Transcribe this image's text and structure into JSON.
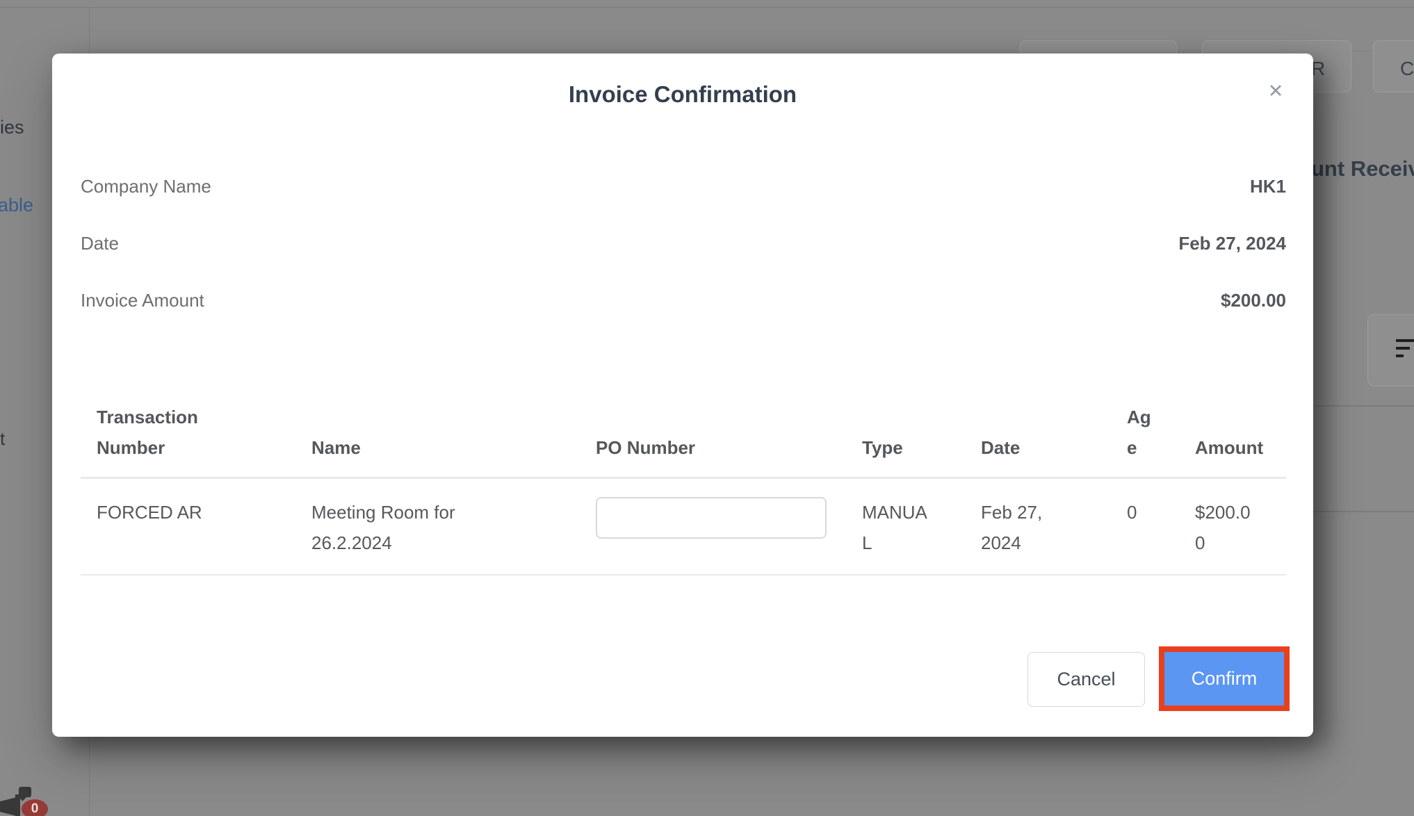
{
  "modal": {
    "title": "Invoice Confirmation",
    "close_icon": "✕",
    "fields": [
      {
        "label": "Company Name",
        "value": "HK1"
      },
      {
        "label": "Date",
        "value": "Feb 27, 2024"
      },
      {
        "label": "Invoice Amount",
        "value": "$200.00"
      }
    ],
    "table": {
      "headers": [
        "Transaction Number",
        "Name",
        "PO Number",
        "Type",
        "Date",
        "Age",
        "Amount"
      ],
      "rows": [
        {
          "transaction_number": "FORCED AR",
          "name": "Meeting Room for 26.2.2024",
          "po_number": "",
          "type": "MANUAL",
          "date": "Feb 27, 2024",
          "age": "0",
          "amount": "$200.00"
        }
      ]
    },
    "buttons": {
      "cancel": "Cancel",
      "confirm": "Confirm"
    }
  },
  "background": {
    "top_buttons": [
      {
        "label": ""
      },
      {
        "label": "R"
      },
      {
        "label": "C"
      }
    ],
    "heading_fragment": "unt Receiv",
    "sidebar_fragments": {
      "item1": "ies",
      "link": "able",
      "item2": "t"
    },
    "notification_badge": "0"
  },
  "colors": {
    "confirm_blue": "#5b96f3",
    "highlight_red": "#e8401f",
    "link_blue": "#3c5e92",
    "badge_red": "#963a37",
    "overlay_gray": "#8a8a8a",
    "title_text": "#333f4d",
    "table_border": "#e8eaec"
  }
}
